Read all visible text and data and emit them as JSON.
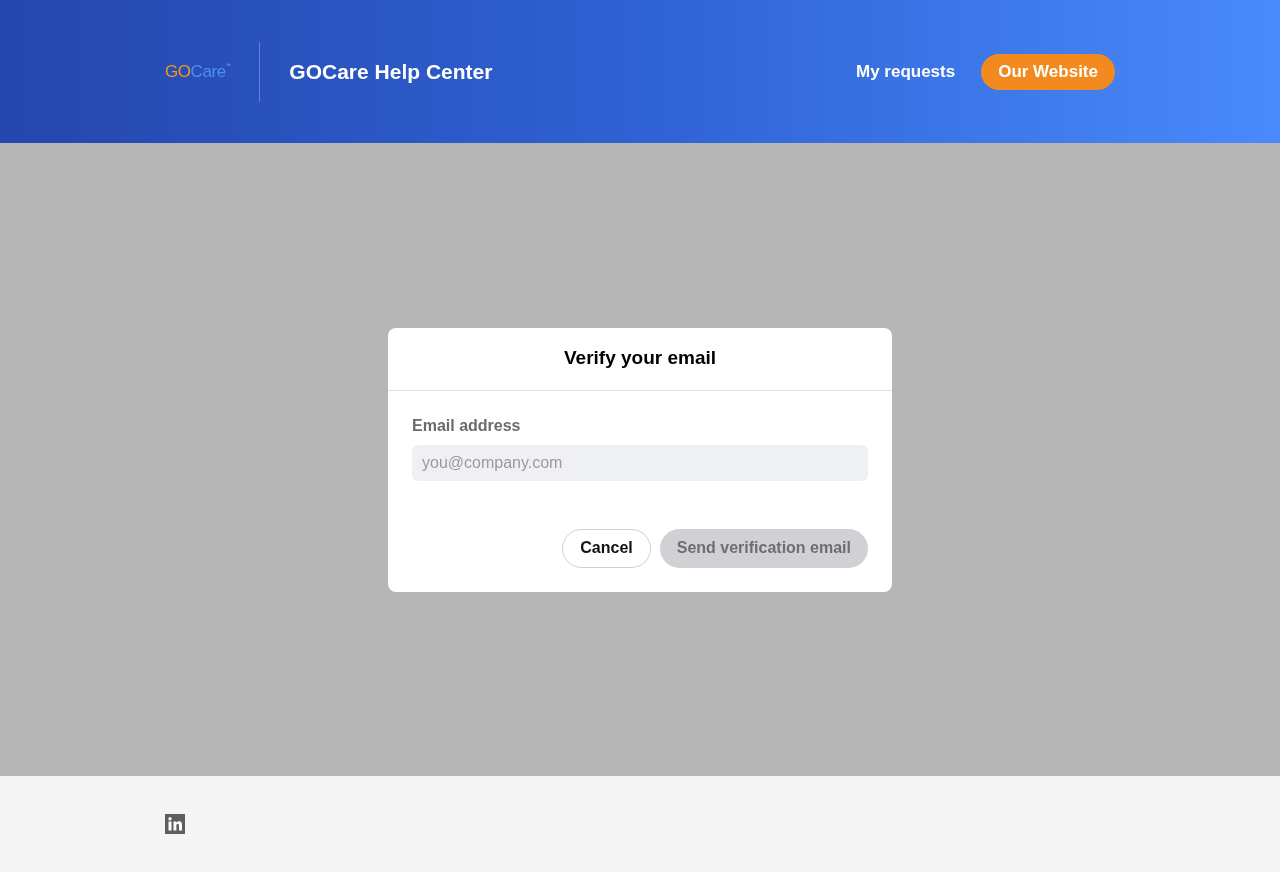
{
  "header": {
    "logo": {
      "first": "GO",
      "second": "Care",
      "mark": "™"
    },
    "title": "GOCare Help Center",
    "nav": [
      {
        "kind": "link",
        "label": "My requests"
      },
      {
        "kind": "button",
        "label": "Our Website"
      }
    ]
  },
  "dialog": {
    "title": "Verify your email",
    "field": {
      "label": "Email address",
      "placeholder": "you@company.com"
    },
    "buttons": [
      {
        "kind": "secondary",
        "label": "Cancel",
        "disabled": false
      },
      {
        "kind": "primary",
        "label": "Send verification email",
        "disabled": true
      }
    ]
  },
  "footer": {
    "social": [
      {
        "kind": "linkedin"
      }
    ]
  }
}
